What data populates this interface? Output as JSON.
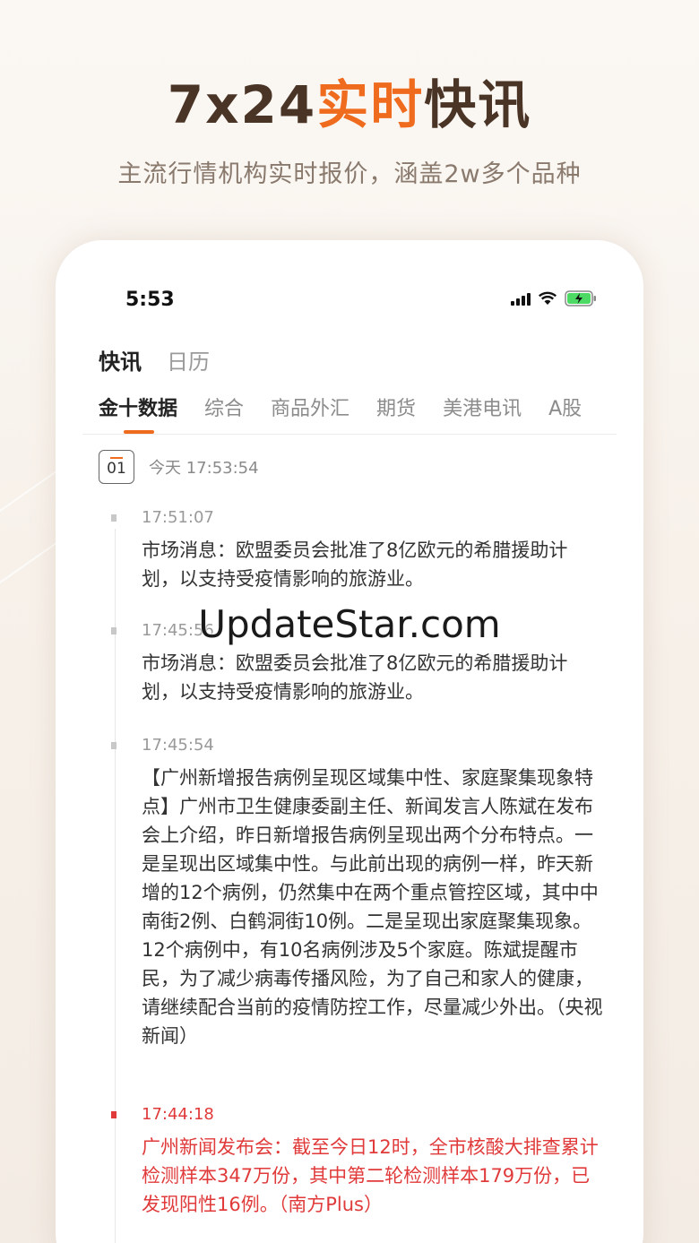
{
  "hero": {
    "title_part1": "7x24",
    "title_accent": "实时",
    "title_part2": "快讯",
    "subtitle": "主流行情机构实时报价，涵盖2w多个品种"
  },
  "status_bar": {
    "time": "5:53",
    "icons": [
      "signal-icon",
      "wifi-icon",
      "battery-charging-icon"
    ]
  },
  "top_tabs": [
    {
      "label": "快讯",
      "active": true
    },
    {
      "label": "日历",
      "active": false
    }
  ],
  "category_tabs": [
    {
      "label": "金十数据",
      "active": true
    },
    {
      "label": "综合",
      "active": false
    },
    {
      "label": "商品外汇",
      "active": false
    },
    {
      "label": "期货",
      "active": false
    },
    {
      "label": "美港电讯",
      "active": false
    },
    {
      "label": "A股",
      "active": false
    }
  ],
  "date_header": {
    "day": "01",
    "text": "今天 17:53:54"
  },
  "news": [
    {
      "time": "17:51:07",
      "text": "市场消息：欧盟委员会批准了8亿欧元的希腊援助计划，以支持受疫情影响的旅游业。",
      "highlight": false
    },
    {
      "time": "17:45:56",
      "text": "市场消息：欧盟委员会批准了8亿欧元的希腊援助计划，以支持受疫情影响的旅游业。",
      "highlight": false
    },
    {
      "time": "17:45:54",
      "text": "【广州新增报告病例呈现区域集中性、家庭聚集现象特点】广州市卫生健康委副主任、新闻发言人陈斌在发布会上介绍，昨日新增报告病例呈现出两个分布特点。一是呈现出区域集中性。与此前出现的病例一样，昨天新增的12个病例，仍然集中在两个重点管控区域，其中中南街2例、白鹤洞街10例。二是呈现出家庭聚集现象。12个病例中，有10名病例涉及5个家庭。陈斌提醒市民，为了减少病毒传播风险，为了自己和家人的健康，请继续配合当前的疫情防控工作，尽量减少外出。（央视新闻）",
      "highlight": false
    },
    {
      "time": "17:44:18",
      "text": "广州新闻发布会：截至今日12时，全市核酸大排查累计检测样本347万份，其中第二轮检测样本179万份，已发现阳性16例。（南方Plus）",
      "highlight": true
    }
  ],
  "watermark": "UpdateStar.com",
  "colors": {
    "accent": "#ef6b1e",
    "alert": "#e03a3a",
    "title": "#4a3426"
  }
}
